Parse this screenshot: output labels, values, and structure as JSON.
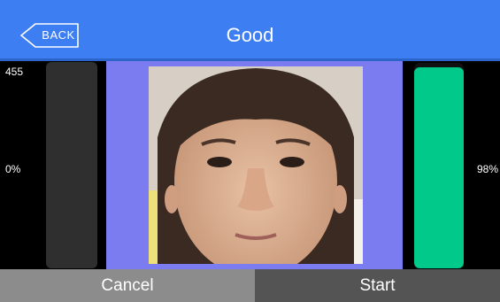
{
  "header": {
    "back_label": "BACK",
    "title": "Good"
  },
  "left_meter": {
    "top_value": "455",
    "percent_label": "0%",
    "level": 0
  },
  "right_meter": {
    "percent_label": "98%",
    "level": 0.98
  },
  "footer": {
    "cancel_label": "Cancel",
    "start_label": "Start"
  },
  "colors": {
    "header": "#3d7ff2",
    "camera_background": "#7b7cf0",
    "meter_fill": "#00c98a",
    "cancel_button": "#8c8c8c",
    "start_button": "#545454"
  }
}
